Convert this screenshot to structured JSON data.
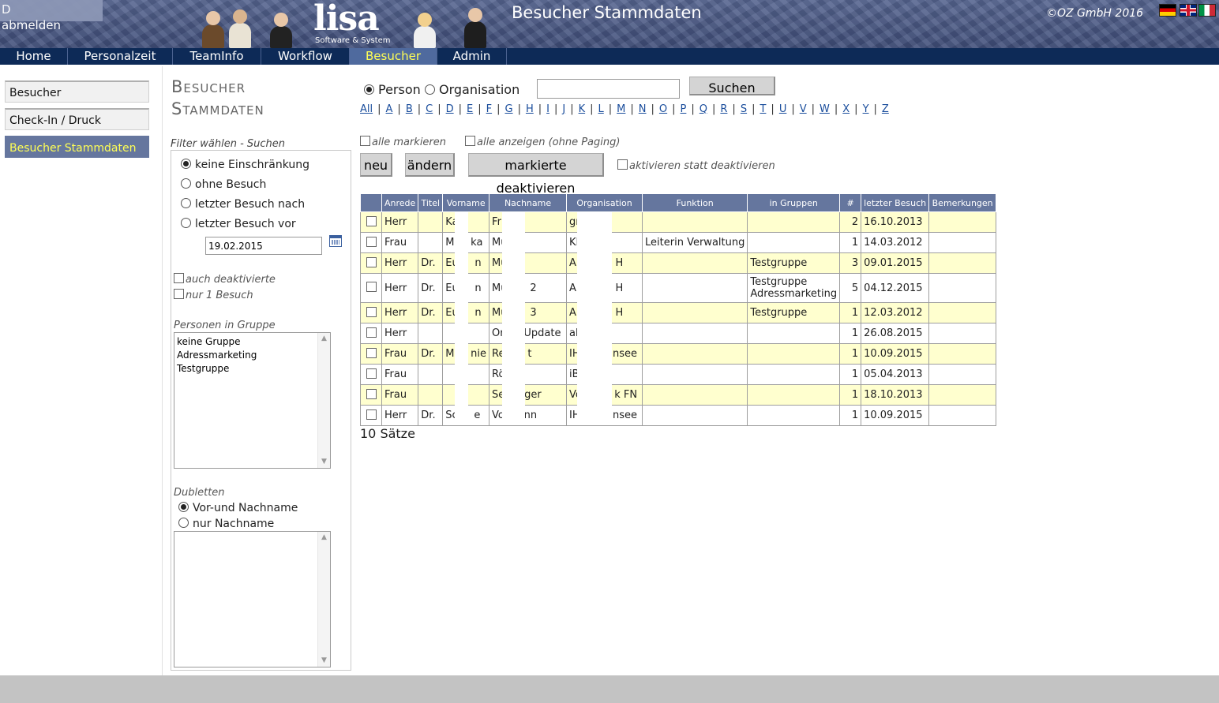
{
  "header": {
    "user_initial": "D",
    "logout_label": "abmelden",
    "logo_text": "lisa",
    "logo_subtitle": "Software & System",
    "page_heading": "Besucher Stammdaten",
    "copyright": "©OZ GmbH 2016",
    "flags": [
      "flag-de-icon",
      "flag-en-icon",
      "flag-it-icon"
    ]
  },
  "nav": {
    "items": [
      {
        "label": "Home"
      },
      {
        "label": "Personalzeit"
      },
      {
        "label": "TeamInfo"
      },
      {
        "label": "Workflow"
      },
      {
        "label": "Besucher",
        "active": true
      },
      {
        "label": "Admin"
      }
    ]
  },
  "sidebar": {
    "items": [
      {
        "label": "Besucher"
      },
      {
        "label": "Check-In / Druck"
      },
      {
        "label": "Besucher Stammdaten",
        "active": true
      }
    ]
  },
  "filter": {
    "page_title_line1": "Besucher",
    "page_title_line2": "Stammdaten",
    "section_label": "Filter wählen - Suchen",
    "options": [
      {
        "label": "keine Einschränkung",
        "selected": true
      },
      {
        "label": "ohne Besuch"
      },
      {
        "label": "letzter Besuch nach"
      },
      {
        "label": "letzter Besuch vor"
      }
    ],
    "date_value": "19.02.2015",
    "auch_deaktivierte": "auch deaktivierte",
    "nur_1_besuch": "nur 1 Besuch",
    "groups_label": "Personen in Gruppe",
    "groups": [
      "keine Gruppe",
      "Adressmarketing",
      "Testgruppe"
    ],
    "dubletten_label": "Dubletten",
    "dubletten_options": [
      {
        "label": "Vor-und Nachname",
        "selected": true
      },
      {
        "label": "nur Nachname"
      }
    ]
  },
  "search": {
    "type_person": "Person",
    "type_org": "Organisation",
    "input_value": "",
    "search_button": "Suchen",
    "alphabet": [
      "All",
      "A",
      "B",
      "C",
      "D",
      "E",
      "F",
      "G",
      "H",
      "I",
      "J",
      "K",
      "L",
      "M",
      "N",
      "O",
      "P",
      "Q",
      "R",
      "S",
      "T",
      "U",
      "V",
      "W",
      "X",
      "Y",
      "Z"
    ]
  },
  "toolbar": {
    "alle_markieren": "alle markieren",
    "alle_anzeigen": "alle anzeigen (ohne Paging)",
    "new_button": "neu",
    "edit_button": "ändern",
    "deactivate_button": "markierte deaktivieren",
    "activate_instead": "aktivieren statt deaktivieren"
  },
  "table": {
    "columns": [
      "Anrede",
      "Titel",
      "Vorname",
      "Nachname",
      "Organisation",
      "Funktion",
      "in Gruppen",
      "#",
      "letzter Besuch",
      "Bemerkungen"
    ],
    "rows": [
      {
        "anrede": "Herr",
        "titel": "",
        "vorname": "Ka",
        "nachname": "Fr",
        "organisation": "gr",
        "funktion": "",
        "gruppen": "",
        "count": "2",
        "besuch": "16.10.2013",
        "bemerkungen": ""
      },
      {
        "anrede": "Frau",
        "titel": "",
        "vorname": "M     ka",
        "nachname": "Mü",
        "organisation": "KF",
        "funktion": "Leiterin Verwaltung",
        "gruppen": "",
        "count": "1",
        "besuch": "14.03.2012",
        "bemerkungen": ""
      },
      {
        "anrede": "Herr",
        "titel": "Dr.",
        "vorname": "Eu     n",
        "nachname": "Mu",
        "organisation": "AE          H",
        "funktion": "",
        "gruppen": "Testgruppe",
        "count": "3",
        "besuch": "09.01.2015",
        "bemerkungen": ""
      },
      {
        "anrede": "Herr",
        "titel": "Dr.",
        "vorname": "Eu     n",
        "nachname": "Mu       2",
        "organisation": "AE          H",
        "funktion": "",
        "gruppen": "Testgruppe\nAdressmarketing",
        "count": "5",
        "besuch": "04.12.2015",
        "bemerkungen": ""
      },
      {
        "anrede": "Herr",
        "titel": "Dr.",
        "vorname": "Eu     n",
        "nachname": "Mu       3",
        "organisation": "AE          H",
        "funktion": "",
        "gruppen": "Testgruppe",
        "count": "1",
        "besuch": "12.03.2012",
        "bemerkungen": ""
      },
      {
        "anrede": "Herr",
        "titel": "",
        "vorname": "",
        "nachname": "Or      Update",
        "organisation": "ab",
        "funktion": "",
        "gruppen": "",
        "count": "1",
        "besuch": "26.08.2015",
        "bemerkungen": ""
      },
      {
        "anrede": "Frau",
        "titel": "Dr.",
        "vorname": "M     nie",
        "nachname": "Re       t",
        "organisation": "IH          nsee",
        "funktion": "",
        "gruppen": "",
        "count": "1",
        "besuch": "10.09.2015",
        "bemerkungen": ""
      },
      {
        "anrede": "Frau",
        "titel": "",
        "vorname": "",
        "nachname": "Rö",
        "organisation": "iB",
        "funktion": "",
        "gruppen": "",
        "count": "1",
        "besuch": "05.04.2013",
        "bemerkungen": ""
      },
      {
        "anrede": "Frau",
        "titel": "",
        "vorname": "",
        "nachname": "Se      ger",
        "organisation": "Vo          k FN",
        "funktion": "",
        "gruppen": "",
        "count": "1",
        "besuch": "18.10.2013",
        "bemerkungen": ""
      },
      {
        "anrede": "Herr",
        "titel": "Dr.",
        "vorname": "Sc     e",
        "nachname": "Vo      nn",
        "organisation": "IH          nsee",
        "funktion": "",
        "gruppen": "",
        "count": "1",
        "besuch": "10.09.2015",
        "bemerkungen": ""
      }
    ],
    "record_count": "10 Sätze"
  }
}
